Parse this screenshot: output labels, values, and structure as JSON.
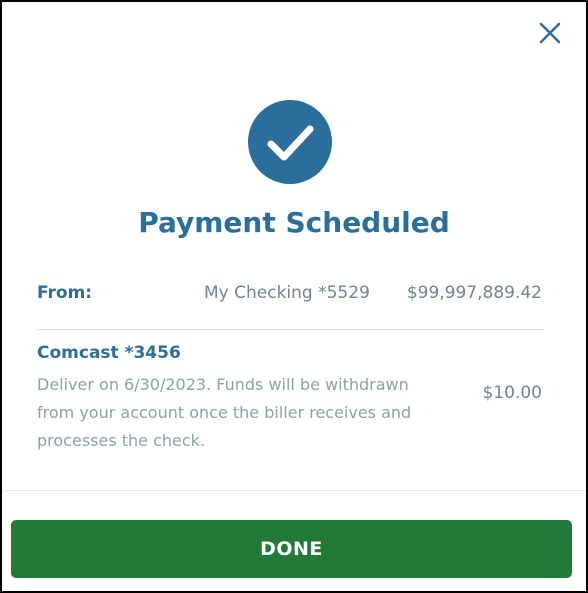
{
  "dialog": {
    "title": "Payment Scheduled",
    "close_icon": "close-icon",
    "success_icon": "check-circle-icon"
  },
  "from": {
    "label": "From:",
    "account": "My Checking *5529",
    "balance": "$99,997,889.42"
  },
  "payment": {
    "payee": "Comcast *3456",
    "description": "Deliver on 6/30/2023. Funds will be withdrawn from your account once the biller receives and processes the check.",
    "amount": "$10.00"
  },
  "actions": {
    "done_label": "DONE"
  },
  "colors": {
    "accent": "#2a6f9b",
    "primary_button": "#217a38",
    "muted_text": "#8fa0ac"
  }
}
